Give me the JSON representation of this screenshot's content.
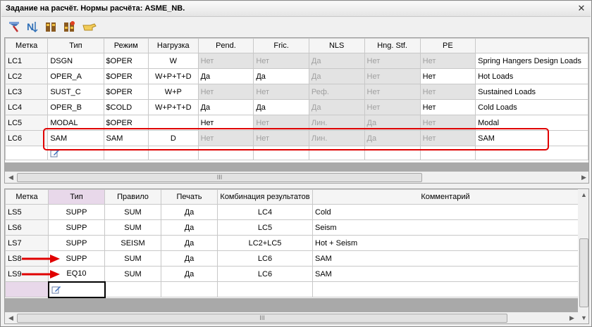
{
  "window": {
    "title": "Задание на расчёт. Нормы расчёта: ASME_NB.",
    "close_label": "✕"
  },
  "toolbar": {
    "icons": [
      "pipe-select-icon",
      "sort-icon",
      "filter-icon",
      "filter-settings-icon",
      "point-hand-icon"
    ]
  },
  "top_grid": {
    "headers": [
      "Метка",
      "Тип",
      "Режим",
      "Нагрузка",
      "Pend.",
      "Fric.",
      "NLS",
      "Hng. Stf.",
      "PE",
      ""
    ],
    "rows": [
      [
        "LC1",
        "DSGN",
        "$OPER",
        "W",
        "Нет",
        "Нет",
        "Да",
        "Нет",
        "Нет",
        "Spring Hangers Design Loads"
      ],
      [
        "LC2",
        "OPER_A",
        "$OPER",
        "W+P+T+D",
        "Да",
        "Да",
        "Да",
        "Нет",
        "Нет",
        "Hot Loads"
      ],
      [
        "LC3",
        "SUST_C",
        "$OPER",
        "W+P",
        "Нет",
        "Нет",
        "Реф.",
        "Нет",
        "Нет",
        "Sustained Loads"
      ],
      [
        "LC4",
        "OPER_B",
        "$COLD",
        "W+P+T+D",
        "Да",
        "Да",
        "Да",
        "Нет",
        "Нет",
        "Cold Loads"
      ],
      [
        "LC5",
        "MODAL",
        "$OPER",
        "",
        "Нет",
        "Нет",
        "Лин.",
        "Да",
        "Нет",
        "Modal"
      ],
      [
        "LC6",
        "SAM",
        "SAM",
        "D",
        "Нет",
        "Нет",
        "Лин.",
        "Да",
        "Нет",
        "SAM"
      ]
    ],
    "gray_mask": [
      [
        0,
        0,
        0,
        0,
        1,
        1,
        1,
        1,
        1,
        0
      ],
      [
        0,
        0,
        0,
        0,
        0,
        0,
        1,
        1,
        0,
        0
      ],
      [
        0,
        0,
        0,
        0,
        1,
        1,
        1,
        1,
        1,
        0
      ],
      [
        0,
        0,
        0,
        0,
        0,
        0,
        1,
        1,
        0,
        0
      ],
      [
        0,
        0,
        0,
        0,
        0,
        1,
        1,
        1,
        1,
        0
      ],
      [
        0,
        0,
        0,
        0,
        1,
        1,
        1,
        1,
        1,
        0
      ]
    ],
    "scroll_grip": "III"
  },
  "bottom_grid": {
    "headers": [
      "Метка",
      "Тип",
      "Правило",
      "Печать",
      "Комбинация результатов",
      "Комментарий"
    ],
    "rows": [
      [
        "LS5",
        "SUPP",
        "SUM",
        "Да",
        "LC4",
        "Cold"
      ],
      [
        "LS6",
        "SUPP",
        "SUM",
        "Да",
        "LC5",
        "Seism"
      ],
      [
        "LS7",
        "SUPP",
        "SEISM",
        "Да",
        "LC2+LC5",
        "Hot + Seism"
      ],
      [
        "LS8",
        "SUPP",
        "SUM",
        "Да",
        "LC6",
        "SAM"
      ],
      [
        "LS9",
        "EQ10",
        "SUM",
        "Да",
        "LC6",
        "SAM"
      ]
    ],
    "scroll_grip": "III"
  },
  "colors": {
    "highlight": "#e00000",
    "arrow": "#e00000",
    "selected_header": "#e8d8ea",
    "disabled_cell": "#e3e3e3"
  }
}
